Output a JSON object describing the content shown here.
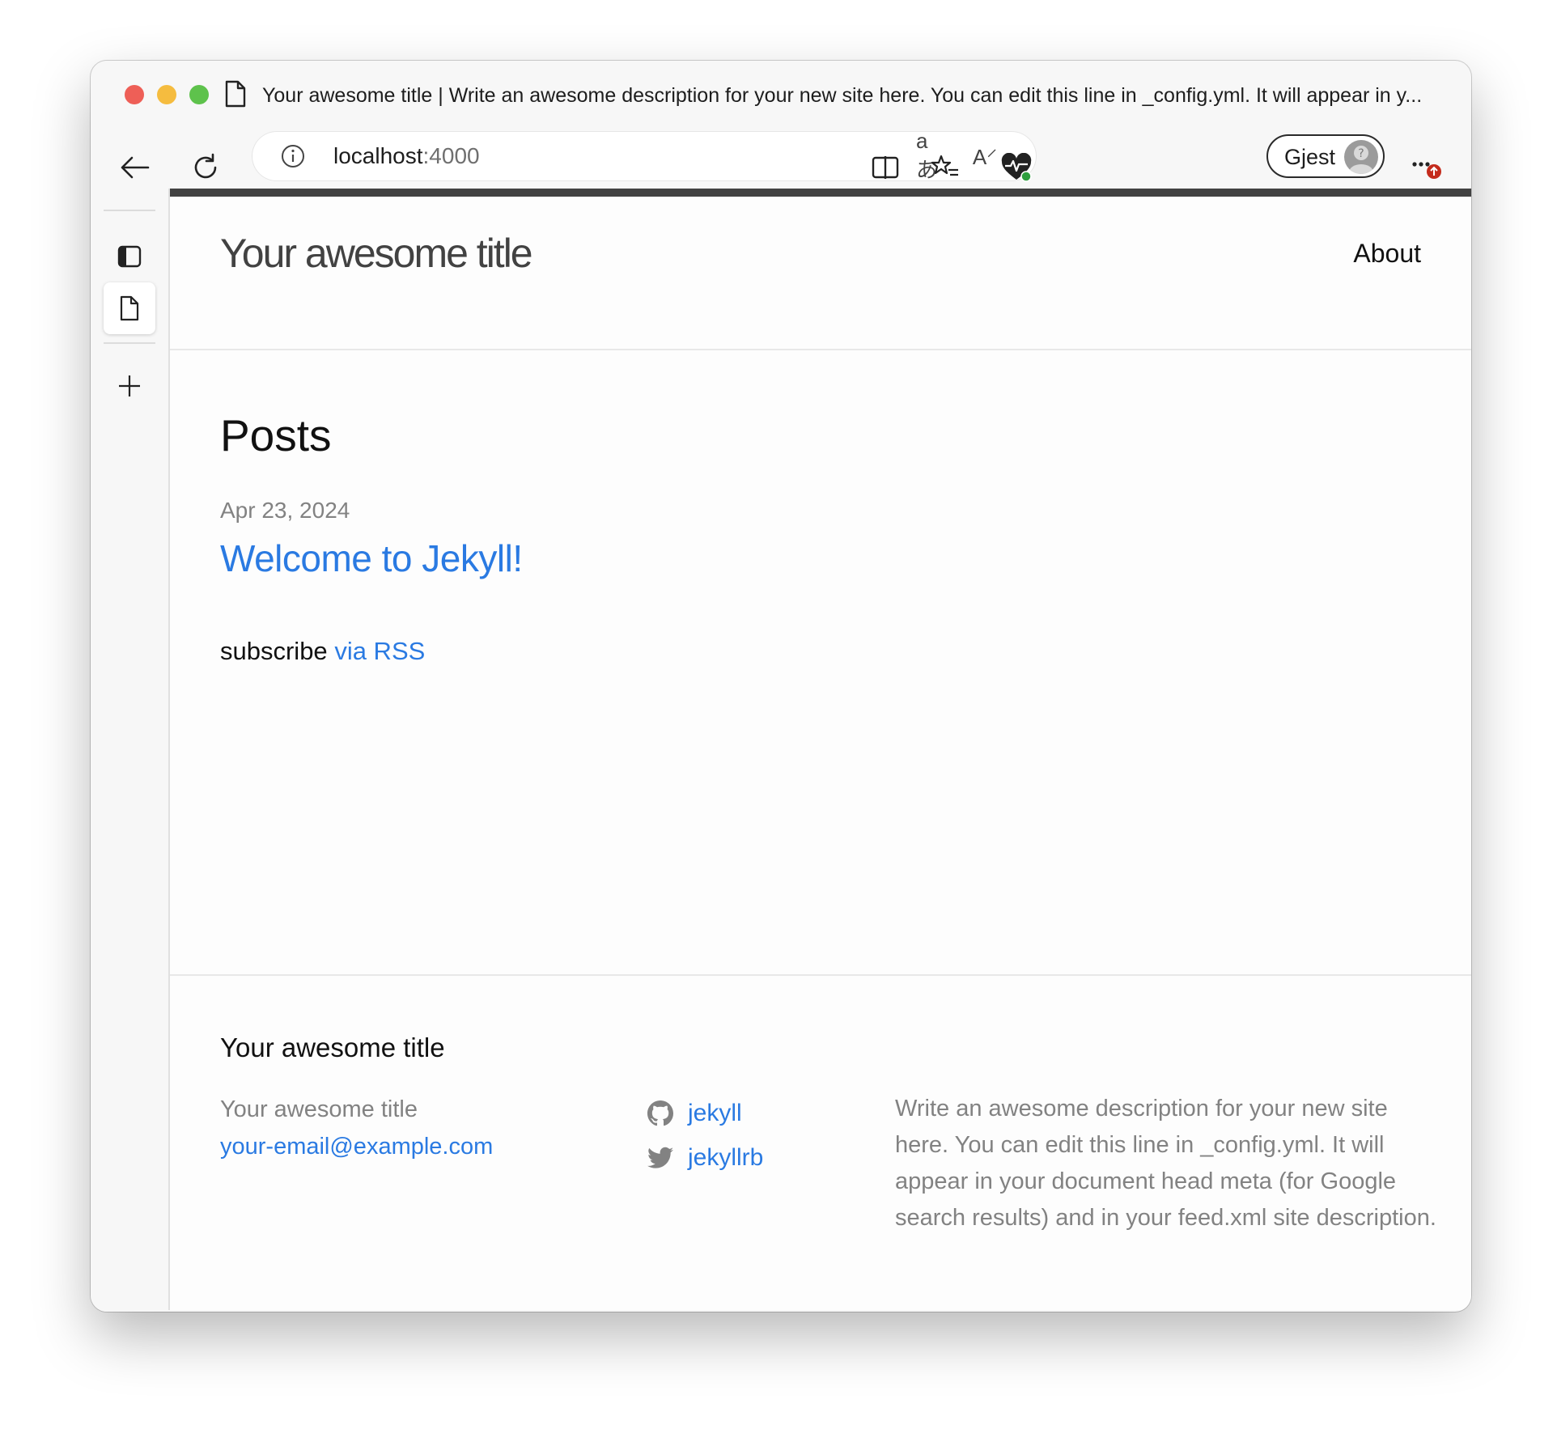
{
  "browser": {
    "tab_title": "Your awesome title | Write an awesome description for your new site here. You can edit this line in _config.yml. It will appear in y...",
    "url_host": "localhost",
    "url_port": ":4000",
    "profile_label": "Gjest"
  },
  "site": {
    "title": "Your awesome title",
    "nav": {
      "about": "About"
    },
    "posts_heading": "Posts",
    "posts": [
      {
        "date": "Apr 23, 2024",
        "title": "Welcome to Jekyll!"
      }
    ],
    "subscribe_prefix": "subscribe",
    "subscribe_link": "via RSS"
  },
  "footer": {
    "heading": "Your awesome title",
    "name": "Your awesome title",
    "email": "your-email@example.com",
    "social": [
      {
        "icon": "github-icon",
        "label": "jekyll"
      },
      {
        "icon": "twitter-icon",
        "label": "jekyllrb"
      }
    ],
    "description": "Write an awesome description for your new site here. You can edit this line in _config.yml. It will appear in your document head meta (for Google search results) and in your feed.xml site description."
  },
  "colors": {
    "link": "#2a7ae2",
    "muted": "#828282",
    "topbar": "#424242"
  }
}
